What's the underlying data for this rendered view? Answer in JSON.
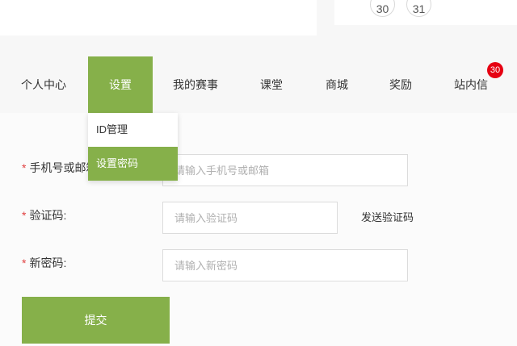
{
  "calendar": {
    "days": [
      "30",
      "31"
    ]
  },
  "nav": {
    "items": [
      {
        "label": "个人中心"
      },
      {
        "label": "设置"
      },
      {
        "label": "我的赛事"
      },
      {
        "label": "课堂"
      },
      {
        "label": "商城"
      },
      {
        "label": "奖励"
      },
      {
        "label": "站内信"
      }
    ],
    "active_index": 1,
    "message_badge": "30",
    "accent_color": "#86b04a",
    "badge_color": "#e60012"
  },
  "dropdown": {
    "items": [
      {
        "label": "ID管理"
      },
      {
        "label": "设置密码"
      }
    ],
    "active_index": 1
  },
  "form": {
    "required_mark": "*",
    "phone": {
      "label": "手机号或邮箱",
      "value": "",
      "placeholder": "请输入手机号或邮箱"
    },
    "code": {
      "label": "验证码:",
      "value": "",
      "placeholder": "请输入验证码"
    },
    "send_code_label": "发送验证码",
    "new_password": {
      "label": "新密码:",
      "value": "",
      "placeholder": "请输入新密码"
    },
    "submit_label": "提交"
  }
}
